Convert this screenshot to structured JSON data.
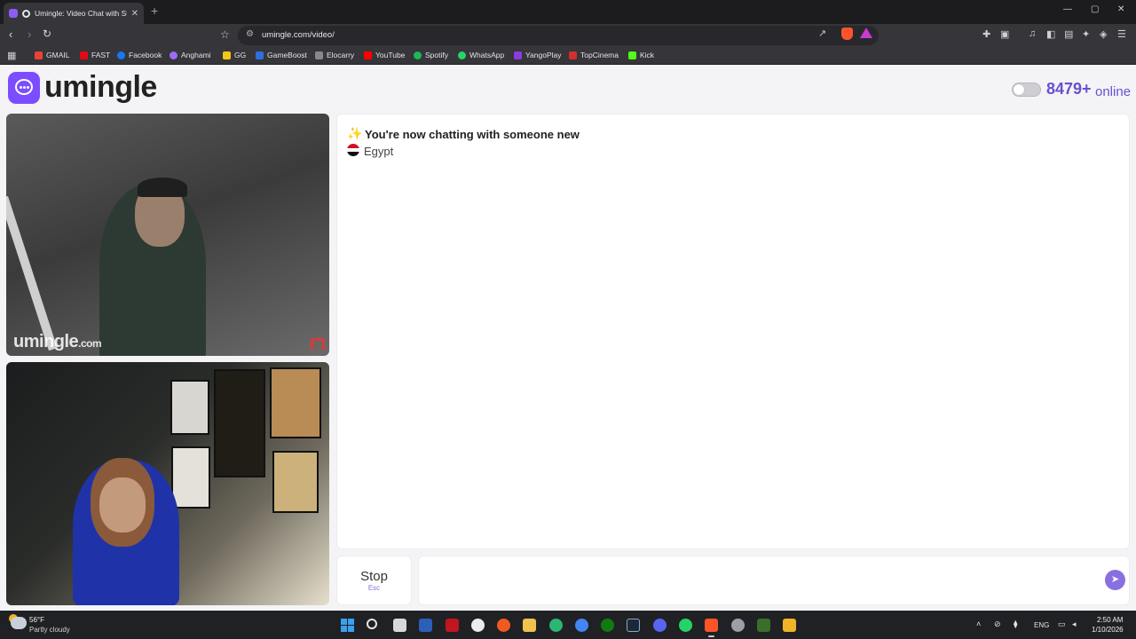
{
  "browser": {
    "tab_title": "Umingle: Video Chat with Strangers",
    "new_tab": "+",
    "url": "umingle.com/video/",
    "window_controls": {
      "minimize": "—",
      "maximize": "▢",
      "close": "✕"
    },
    "bookmarks": [
      {
        "label": "GMAIL",
        "icon": "gmail-icon",
        "color": "#ea4335"
      },
      {
        "label": "FAST",
        "icon": "fast-icon",
        "color": "#e50914"
      },
      {
        "label": "Facebook",
        "icon": "facebook-icon",
        "color": "#1877f2"
      },
      {
        "label": "Anghami",
        "icon": "anghami-icon",
        "color": "#9f6bf5"
      },
      {
        "label": "GG",
        "icon": "gg-icon",
        "color": "#f5c518"
      },
      {
        "label": "GameBoost",
        "icon": "gameboost-icon",
        "color": "#2f6fe0"
      },
      {
        "label": "Elocarry",
        "icon": "elocarry-icon",
        "color": "#888888"
      },
      {
        "label": "YouTube",
        "icon": "youtube-icon",
        "color": "#ff0000"
      },
      {
        "label": "Spotify",
        "icon": "spotify-icon",
        "color": "#1db954"
      },
      {
        "label": "WhatsApp",
        "icon": "whatsapp-icon",
        "color": "#25d366"
      },
      {
        "label": "YangoPlay",
        "icon": "yangoplay-icon",
        "color": "#8b3ce0"
      },
      {
        "label": "TopCinema",
        "icon": "topcinema-icon",
        "color": "#d32f2f"
      },
      {
        "label": "Kick",
        "icon": "kick-icon",
        "color": "#53fc18"
      }
    ]
  },
  "site": {
    "logo_text": "umingle",
    "online_count": "8479+",
    "online_label": "online",
    "brand_color": "#7c4dff"
  },
  "video": {
    "watermark": "umingle",
    "watermark_suffix": ".com"
  },
  "chat": {
    "status": "You're now chatting with someone new",
    "country": "Egypt",
    "stop_label": "Stop",
    "stop_hint": "Esc",
    "message_value": "",
    "send_icon": "send-icon"
  },
  "taskbar": {
    "weather_temp": "56°F",
    "weather_desc": "Partly cloudy",
    "language": "ENG",
    "time": "2:50 AM",
    "date": "1/10/2026"
  }
}
